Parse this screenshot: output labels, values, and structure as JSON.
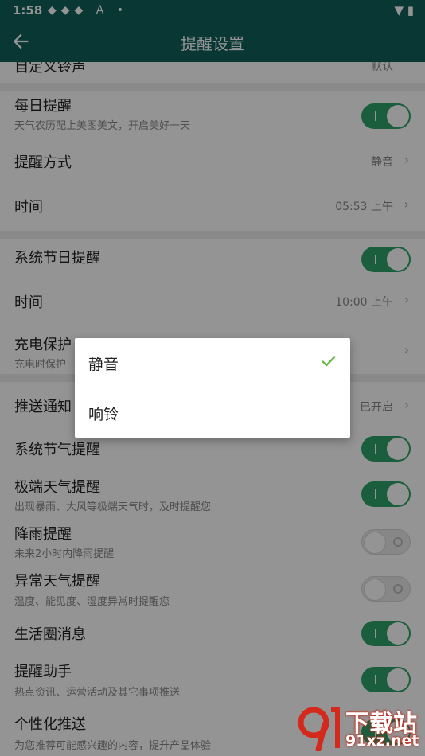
{
  "status_bar": {
    "time": "1:58",
    "notification_icons": "◆◆◆ A •",
    "signal": "▼ ▮"
  },
  "app_bar": {
    "title": "提醒设置"
  },
  "rows": {
    "custom_ringtone": {
      "label": "自定义铃声",
      "value": "默认"
    },
    "daily_reminder": {
      "label": "每日提醒",
      "sub": "天气农历配上美图美文，开启美好一天",
      "on": true
    },
    "reminder_mode": {
      "label": "提醒方式",
      "value": "静音"
    },
    "daily_time": {
      "label": "时间",
      "value": "05:53 上午"
    },
    "holiday_reminder": {
      "label": "系统节日提醒",
      "on": true
    },
    "holiday_time": {
      "label": "时间",
      "value": "10:00 上午"
    },
    "charging": {
      "label": "充电保护",
      "sub": "充电时保护"
    },
    "push_notification": {
      "label": "推送通知",
      "value": "已开启"
    },
    "solar_term": {
      "label": "系统节气提醒",
      "on": true
    },
    "extreme_weather": {
      "label": "极端天气提醒",
      "sub": "出现暴雨、大风等极端天气时，及时提醒您",
      "on": true
    },
    "rain": {
      "label": "降雨提醒",
      "sub": "未来2小时内降雨提醒",
      "on": false
    },
    "abnormal_weather": {
      "label": "异常天气提醒",
      "sub": "温度、能见度、湿度异常时提醒您",
      "on": false
    },
    "life_circle": {
      "label": "生活圈消息",
      "on": true
    },
    "assistant": {
      "label": "提醒助手",
      "sub": "热点资讯、运营活动及其它事项推送",
      "on": true
    },
    "personalized": {
      "label": "个性化推送",
      "sub": "为您推荐可能感兴趣的内容，提升产品体验",
      "on": true
    }
  },
  "dialog": {
    "options": [
      {
        "label": "静音",
        "selected": true
      },
      {
        "label": "响铃",
        "selected": false
      }
    ]
  },
  "watermark": {
    "title": "下载站",
    "url": "91xz.net"
  },
  "colors": {
    "accent": "#2fa36b",
    "header": "#0f5f5b",
    "check": "#66bb44"
  }
}
